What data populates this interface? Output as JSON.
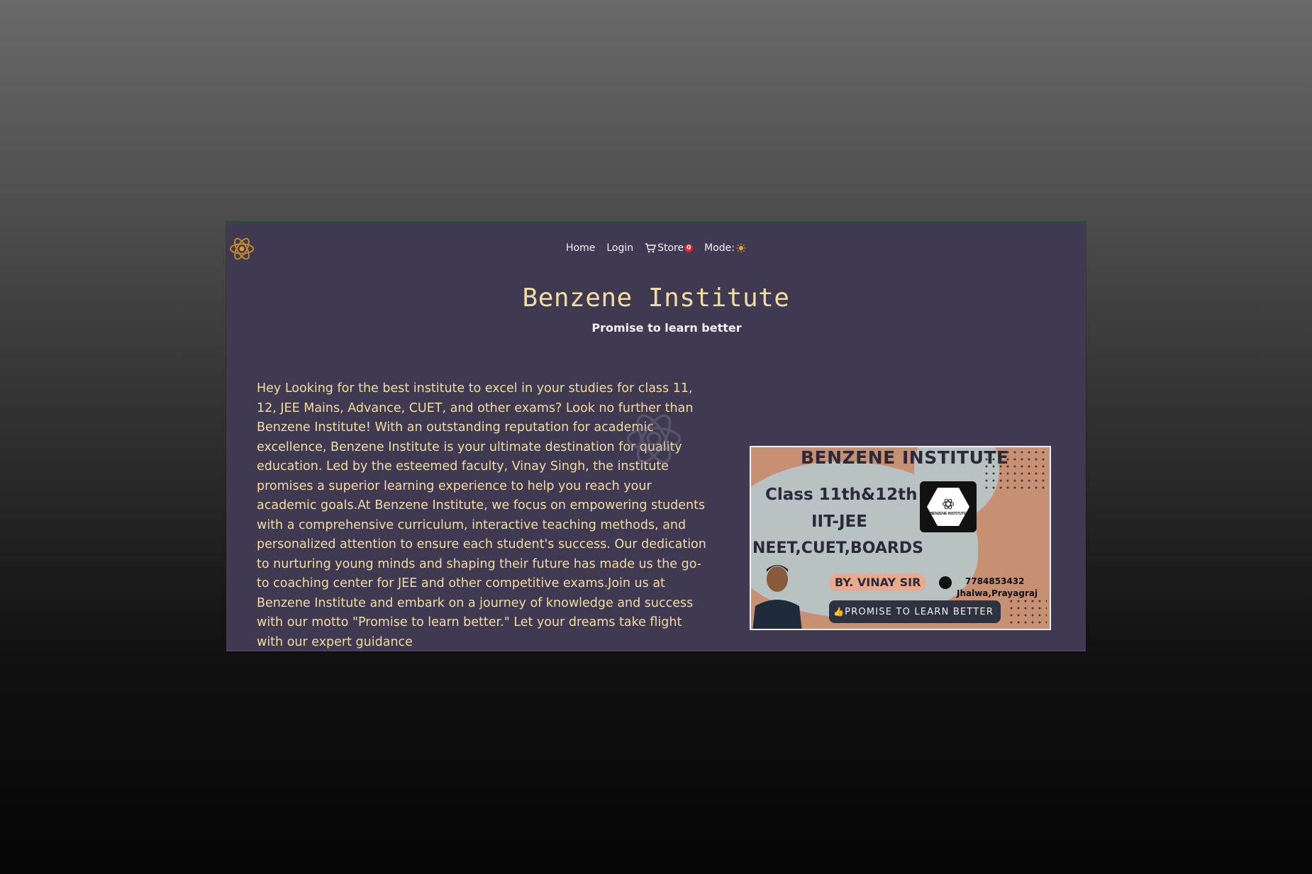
{
  "nav": {
    "home": "Home",
    "login": "Login",
    "store": "Store",
    "cart_count": "0",
    "mode": "Mode:"
  },
  "hero": {
    "title": "Benzene Institute",
    "subtitle": "Promise to learn better"
  },
  "intro_text": "Hey Looking for the best institute to excel in your studies for class 11, 12, JEE Mains, Advance, CUET, and other exams? Look no further than Benzene Institute! With an outstanding reputation for academic excellence, Benzene Institute is your ultimate destination for quality education. Led by the esteemed faculty, Vinay Singh, the institute promises a superior learning experience to help you reach your academic goals.At Benzene Institute, we focus on empowering students with a comprehensive curriculum, interactive teaching methods, and personalized attention to ensure each student's success. Our dedication to nurturing young minds and shaping their future has made us the go-to coaching center for JEE and other competitive exams.Join us at Benzene Institute and embark on a journey of knowledge and success with our motto \"Promise to learn better.\" Let your dreams take flight with our expert guidance",
  "banner": {
    "title": "BENZENE INSTITUTE",
    "classes": "Class 11th&12th",
    "iit": "IIT-JEE",
    "exams": "NEET,CUET,BOARDS",
    "logo_text": "BENZENE INSTITUTE",
    "by": "BY. VINAY SIR",
    "phone": "7784853432",
    "address": "Jhalwa,Prayagraj",
    "promise": "PROMISE TO LEARN BETTER"
  },
  "colors": {
    "page_bg": "#3f3a51",
    "title": "#f2dca0",
    "badge": "#d9262e"
  }
}
